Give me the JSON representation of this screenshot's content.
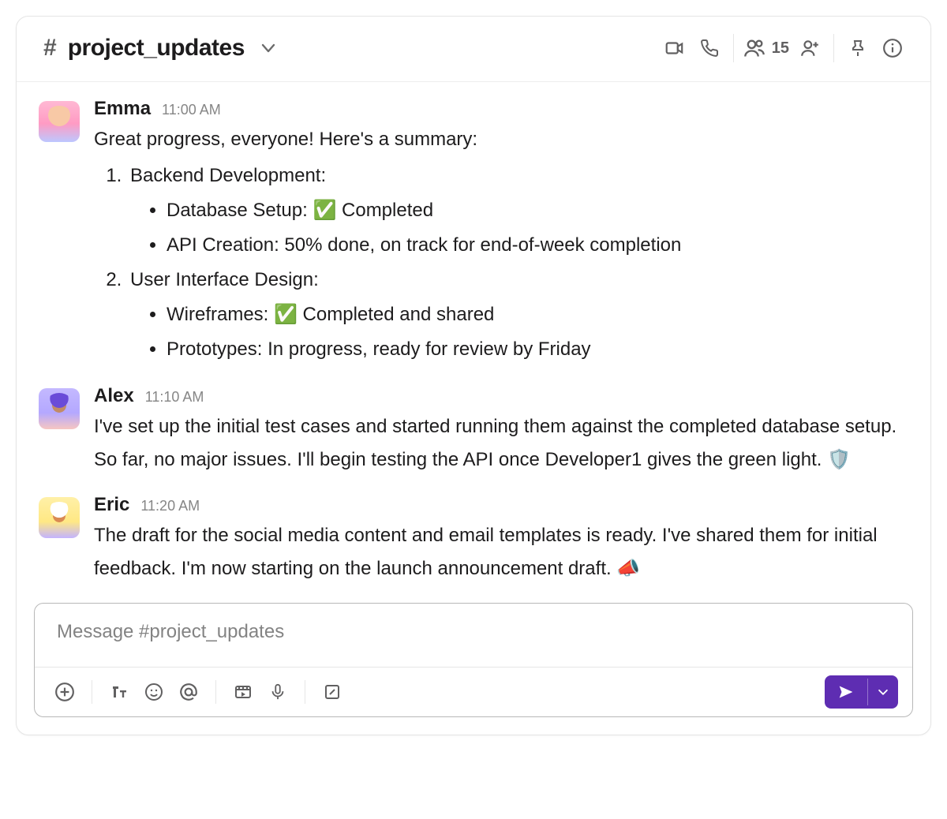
{
  "header": {
    "hash": "#",
    "channel_name": "project_updates",
    "members_count": "15"
  },
  "messages": [
    {
      "author": "Emma",
      "time": "11:00 AM",
      "intro": "Great progress, everyone! Here's a summary:",
      "sections": [
        {
          "title": "Backend Development:",
          "items": [
            "Database Setup: ✅ Completed",
            "API Creation: 50% done, on track for end-of-week completion"
          ]
        },
        {
          "title": "User Interface Design:",
          "items": [
            "Wireframes: ✅ Completed and shared",
            "Prototypes: In progress, ready for review by Friday"
          ]
        }
      ]
    },
    {
      "author": "Alex",
      "time": "11:10 AM",
      "text": "I've set up the initial test cases and started running them against the completed database setup. So far, no major issues. I'll begin testing the API once Developer1 gives the green light. 🛡️"
    },
    {
      "author": "Eric",
      "time": "11:20 AM",
      "text": "The draft for the social media content and email templates is ready. I've shared them for initial feedback. I'm now starting on the launch announcement draft. 📣"
    }
  ],
  "composer": {
    "placeholder": "Message #project_updates"
  }
}
